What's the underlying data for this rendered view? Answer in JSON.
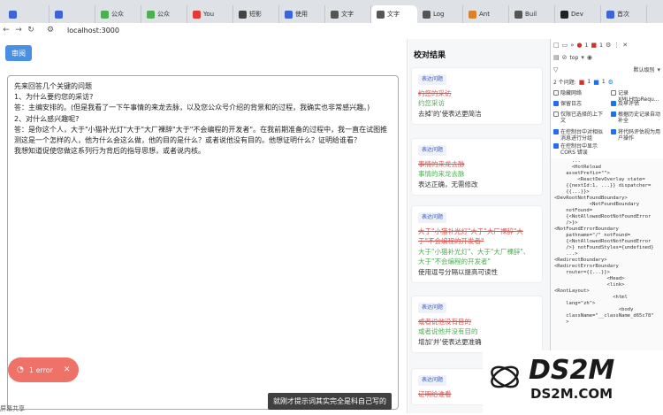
{
  "tabs": [
    {
      "label": "",
      "color": "#3c63d8"
    },
    {
      "label": "",
      "color": "#3c63d8"
    },
    {
      "label": "公众",
      "color": "#4caf50"
    },
    {
      "label": "公众",
      "color": "#4caf50"
    },
    {
      "label": "You",
      "color": "#e53935"
    },
    {
      "label": "短影",
      "color": "#444444"
    },
    {
      "label": "使用",
      "color": "#3c63d8"
    },
    {
      "label": "文字",
      "color": "#555555"
    },
    {
      "label": "文字",
      "color": "#555555",
      "active": true
    },
    {
      "label": "Log",
      "color": "#555555"
    },
    {
      "label": "Ant",
      "color": "#d9822b"
    },
    {
      "label": "Buil",
      "color": "#555555"
    },
    {
      "label": "Dev",
      "color": "#222222"
    },
    {
      "label": "首次",
      "color": "#3c63d8"
    }
  ],
  "address": {
    "url": "localhost:3000"
  },
  "toolbar": {
    "review_label": "审阅"
  },
  "editor": {
    "lines": [
      "先来回答几个关键的问题",
      "1、为什么要约您的采访?",
      "答：主编安排的。(但是我看了一下午事情的来龙去脉，以及您公众号介绍的背景和的过程，我确实也非常感兴趣。)",
      "2、对什么感兴趣呢?",
      "答：是你这个人，大于\"小猫补光灯\"大于\"大厂裸辞\"大于\"不会编程的开发者\"。在我前期准备的过程中，我一直在试图推测这是一个怎样的人，他为什么会这么做，他的目的是什么？或者说他没有目的。他想证明什么？证明给谁看？",
      "我想知道促使您做这系列行为背后的指导思想，或者说内核。"
    ]
  },
  "error_pill": {
    "label": "1 error"
  },
  "caption": {
    "text": "就刚才提示词其实完全是科自己写的"
  },
  "bottom_left": {
    "text": "屏幕共享"
  },
  "results": {
    "title": "校对结果",
    "cards": [
      {
        "tag": "表达问题",
        "original": "约您的采访",
        "fix": "约您采访",
        "reason": "去掉'的'使表达更简洁"
      },
      {
        "tag": "表达问题",
        "original": "事情的来龙去脉",
        "fix": "事情的来龙去脉",
        "reason": "表达正确，无需修改"
      },
      {
        "tag": "表达问题",
        "original": "大于\"小猫补光灯\"大于\"大厂裸辞\"大于\"不会编程的开发者\"",
        "fix": "大于\"小猫补光灯\"、大于\"大厂裸辞\"、大于\"不会编程的开发者\"",
        "reason": "使用逗号分隔以提高可读性"
      },
      {
        "tag": "表达问题",
        "original": "或者说他没有目的",
        "fix": "或者说他并没有目的",
        "reason": "增加'并'使表达更准确"
      },
      {
        "tag": "表达问题",
        "original": "证明给谁看",
        "fix": "",
        "reason": ""
      }
    ]
  },
  "devtools": {
    "context": "top",
    "default_levels": "默认级别",
    "issues": "2 个问题:",
    "issue_count_1": "1",
    "issue_count_2": "1",
    "options": [
      {
        "label": "隐藏网络",
        "checked": false
      },
      {
        "label": "记录 XMLHttpRequ...",
        "checked": false
      },
      {
        "label": "保留日志",
        "checked": true
      },
      {
        "label": "及早评估",
        "checked": true
      },
      {
        "label": "仅限已选择的上下文",
        "checked": false
      },
      {
        "label": "根据历史记录自动补全",
        "checked": true
      },
      {
        "label": "在控制台中对相似消息进行分组",
        "checked": true
      },
      {
        "label": "将代码评估视为用户操作",
        "checked": true
      },
      {
        "label": "在控制台中显示 CORS 错误",
        "checked": true
      }
    ],
    "dom_lines": [
      "      ...",
      "      <HotReload",
      "    assetPrefix=\"\">",
      "        <ReactDevOverlay state=",
      "    {{nextId:1, ...}} dispatcher=",
      "    {{...}}>",
      "",
      "<DevRootNotFoundBoundary>",
      "            <NotFoundBoundary",
      "    notFound=",
      "    {<NotAllowedRootNotFoundError",
      "    />}>",
      "",
      "<NotFoundErrorBoundary",
      "    pathname=\"/\" notFound=",
      "    {<NotAllowedRootNotFoundError",
      "    />} notFoundStyles={undefined}",
      "    ...>",
      "",
      "<RedirectBoundary>",
      "",
      "<RedirectErrorBoundary",
      "    router={{...}}>",
      "                  <Head>",
      "                  <link>",
      "",
      "<RootLayout>",
      "                    <html",
      "    lang=\"zh\">",
      "                      <body",
      "",
      "    className=\"__className_d65c78\"",
      "    >"
    ]
  }
}
